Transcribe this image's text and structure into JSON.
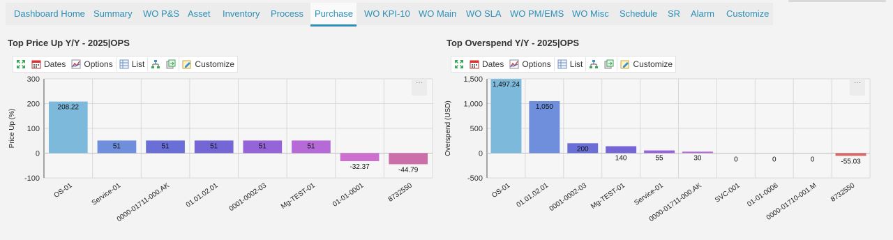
{
  "nav": {
    "tabs": [
      {
        "label": "Dashboard Home",
        "active": false
      },
      {
        "label": "Summary",
        "active": false
      },
      {
        "label": "WO P&S",
        "active": false
      },
      {
        "label": "Asset",
        "active": false
      },
      {
        "label": "Inventory",
        "active": false
      },
      {
        "label": "Process",
        "active": false
      },
      {
        "label": "Purchase",
        "active": true
      },
      {
        "label": "WO KPI-10",
        "active": false
      },
      {
        "label": "WO Main",
        "active": false
      },
      {
        "label": "WO SLA",
        "active": false
      },
      {
        "label": "WO PM/EMS",
        "active": false
      },
      {
        "label": "WO Misc",
        "active": false
      },
      {
        "label": "Schedule",
        "active": false
      },
      {
        "label": "SR",
        "active": false
      },
      {
        "label": "Alarm",
        "active": false
      },
      {
        "label": "Customize",
        "active": false
      }
    ]
  },
  "toolbar": {
    "dates_label": "Dates",
    "options_label": "Options",
    "list_label": "List",
    "customize_label": "Customize"
  },
  "menu_label": "···",
  "panels": {
    "left": {
      "title": "Top Price Up Y/Y - 2025|OPS"
    },
    "right": {
      "title": "Top Overspend Y/Y - 2025|OPS"
    }
  },
  "chart_data": [
    {
      "type": "bar",
      "title": "Top Price Up Y/Y - 2025|OPS",
      "ylabel": "Price Up (%)",
      "xlabel": "",
      "ylim": [
        -100,
        300
      ],
      "yticks": [
        -100,
        0,
        100,
        200,
        300
      ],
      "ytick_labels": [
        "-100",
        "0",
        "100",
        "200",
        "300"
      ],
      "grid": true,
      "categories": [
        "OS-01",
        "Service-01",
        "0000-01711-000.AK",
        "01.01.02.01",
        "0001-0002-03",
        "Mg-TEST-01",
        "01-01-0001",
        "8732550"
      ],
      "values": [
        208.22,
        51,
        51,
        51,
        51,
        51,
        -32.37,
        -44.79
      ],
      "value_labels": [
        "208.22",
        "51",
        "51",
        "51",
        "51",
        "51",
        "-32.37",
        "-44.79"
      ],
      "colors": [
        "#7db9db",
        "#6f8fdd",
        "#6a6fd8",
        "#7566d6",
        "#9664d9",
        "#b56ad8",
        "#cc6fcf",
        "#cc6fa9"
      ]
    },
    {
      "type": "bar",
      "title": "Top Overspend Y/Y - 2025|OPS",
      "ylabel": "Overspend (USD)",
      "xlabel": "",
      "ylim": [
        -500,
        1500
      ],
      "yticks": [
        -500,
        0,
        500,
        1000,
        1500
      ],
      "ytick_labels": [
        "-500",
        "0",
        "500",
        "1,000",
        "1,500"
      ],
      "grid": true,
      "categories": [
        "OS-01",
        "01.01.02.01",
        "0001-0002-03",
        "Mg-TEST-01",
        "Service-01",
        "0000-01711-000.AK",
        "SVC-001",
        "01-01-0006",
        "0000-01710-001.M",
        "8732550"
      ],
      "values": [
        1497.24,
        1050,
        200,
        140,
        55,
        30,
        0,
        0,
        0,
        -55.03
      ],
      "value_labels": [
        "1,497.24",
        "1,050",
        "200",
        "140",
        "55",
        "30",
        "0",
        "0",
        "0",
        "-55.03"
      ],
      "colors": [
        "#7db9db",
        "#6f8fdd",
        "#6a6fd8",
        "#7566d6",
        "#9664d9",
        "#b56ad8",
        "#b56ad8",
        "#cc6fcf",
        "#cc6fa9",
        "#d96a6a"
      ]
    }
  ]
}
